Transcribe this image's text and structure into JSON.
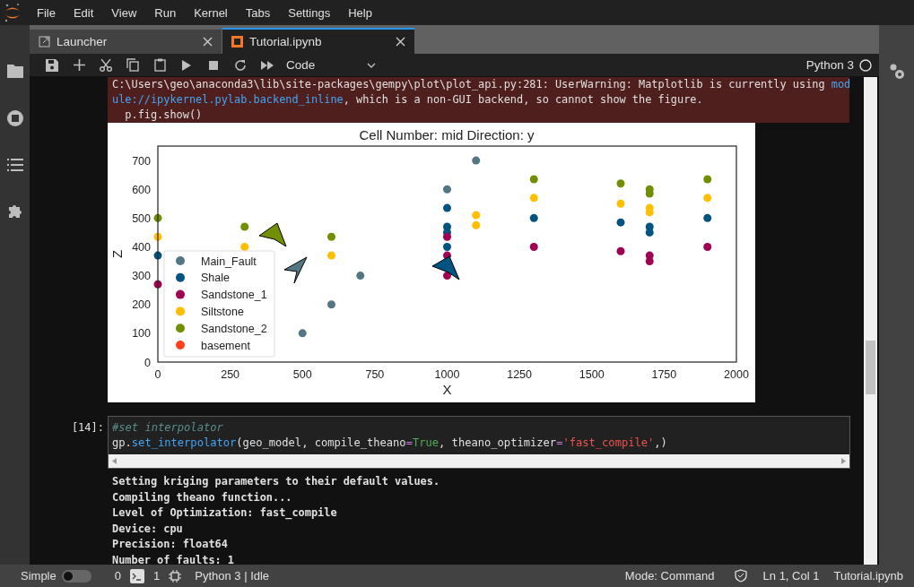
{
  "menu": [
    "File",
    "Edit",
    "View",
    "Run",
    "Kernel",
    "Tabs",
    "Settings",
    "Help"
  ],
  "tabs": [
    {
      "label": "Launcher",
      "selected": false,
      "kind": "launcher"
    },
    {
      "label": "Tutorial.ipynb",
      "selected": true,
      "kind": "notebook"
    }
  ],
  "toolbar": {
    "cell_type": "Code",
    "kernel": "Python 3"
  },
  "notebook": {
    "stderr": [
      [
        {
          "text": "C:\\Users\\geo\\anaconda3\\lib\\site-packages\\gempy\\plot\\plot_api.py:281: UserWarning: Matplotlib is currently using ",
          "kind": "text"
        },
        {
          "text": "mod",
          "kind": "link"
        }
      ],
      [
        {
          "text": "ule://ipykernel.pylab.backend_inline",
          "kind": "link"
        },
        {
          "text": ", which is a non-GUI backend, so cannot show the figure.",
          "kind": "text"
        }
      ],
      [
        {
          "text": "  p.fig.show()",
          "kind": "text"
        }
      ]
    ],
    "figure": {
      "chart_data": {
        "type": "scatter",
        "title": "Cell Number: mid Direction: y",
        "xlabel": "X",
        "ylabel": "Z",
        "xlim": [
          0,
          2000
        ],
        "ylim": [
          0,
          750
        ],
        "legend": true,
        "xticks": [
          0,
          250,
          500,
          750,
          1000,
          1250,
          1500,
          1750,
          2000
        ],
        "yticks": [
          0,
          100,
          200,
          300,
          400,
          500,
          600,
          700
        ],
        "series": [
          {
            "name": "Main_Fault",
            "color": "#527682",
            "x": [
              500,
              600,
              700,
              1000,
              1100
            ],
            "values": [
              100,
              200,
              300,
              600,
              700
            ]
          },
          {
            "name": "Shale",
            "color": "#015482",
            "x": [
              0,
              1000,
              1000,
              1000,
              1000,
              1300,
              1600,
              1700,
              1700,
              1900
            ],
            "values": [
              370,
              535,
              470,
              450,
              400,
              500,
              485,
              470,
              450,
              500
            ]
          },
          {
            "name": "Sandstone_1",
            "color": "#9f0052",
            "x": [
              0,
              1000,
              1000,
              1000,
              1300,
              1600,
              1700,
              1700,
              1900
            ],
            "values": [
              270,
              435,
              370,
              300,
              400,
              385,
              370,
              350,
              400
            ]
          },
          {
            "name": "Siltstone",
            "color": "#ffbe00",
            "x": [
              0,
              300,
              600,
              1100,
              1100,
              1300,
              1600,
              1700,
              1700,
              1900
            ],
            "values": [
              435,
              400,
              370,
              510,
              475,
              570,
              550,
              535,
              520,
              570
            ]
          },
          {
            "name": "Sandstone_2",
            "color": "#728f02",
            "x": [
              0,
              300,
              600,
              1300,
              1600,
              1700,
              1700,
              1900
            ],
            "values": [
              500,
              470,
              435,
              635,
              620,
              600,
              585,
              635
            ]
          },
          {
            "name": "basement",
            "color": "#ff3f20"
          }
        ]
      }
    },
    "cells": [
      {
        "prompt": "[14]:",
        "code": [
          [
            {
              "kind": "comment",
              "t": "#set interpolator"
            }
          ],
          [
            {
              "kind": "plain",
              "t": "gp."
            },
            {
              "kind": "name",
              "t": "set_interpolator"
            },
            {
              "kind": "plain",
              "t": "(geo_model, compile_theano"
            },
            {
              "kind": "op",
              "t": "="
            },
            {
              "kind": "keyword",
              "t": "True"
            },
            {
              "kind": "plain",
              "t": ", theano_optimizer"
            },
            {
              "kind": "op",
              "t": "="
            },
            {
              "kind": "string",
              "t": "'fast_compile'"
            },
            {
              "kind": "plain",
              "t": ",)"
            }
          ]
        ],
        "output": [
          "Setting kriging parameters to their default values.",
          "Compiling theano function...",
          "Level of Optimization:  fast_compile",
          "Device:  cpu",
          "Precision:  float64",
          "Number of faults:  1"
        ]
      }
    ]
  },
  "status_bar": {
    "simple_label": "Simple",
    "simple_mode": false,
    "terminals": "0",
    "kernels": "1",
    "kernel_status": "Python 3 | Idle",
    "mode": "Mode: Command",
    "position": "Ln 1, Col 1",
    "file": "Tutorial.ipynb"
  }
}
